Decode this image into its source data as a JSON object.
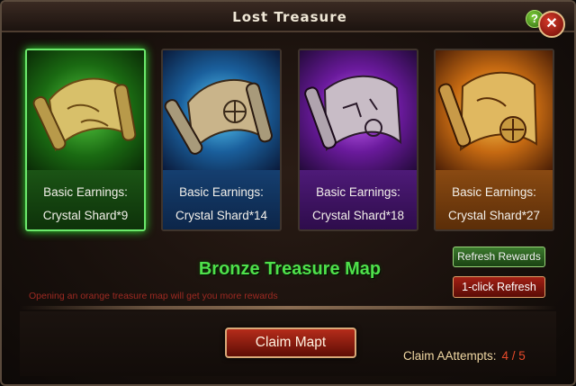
{
  "window": {
    "title": "Lost Treasure"
  },
  "titlebar": {
    "help_label": "?",
    "close_label": "✕"
  },
  "cards": [
    {
      "tier": "green",
      "line1": "Basic Earnings:",
      "line2": "Crystal Shard*9",
      "selected": true
    },
    {
      "tier": "blue",
      "line1": "Basic Earnings:",
      "line2": "Crystal Shard*14",
      "selected": false
    },
    {
      "tier": "purple",
      "line1": "Basic Earnings:",
      "line2": "Crystal Shard*18",
      "selected": false
    },
    {
      "tier": "orange",
      "line1": "Basic Earnings:",
      "line2": "Crystal Shard*27",
      "selected": false
    }
  ],
  "current_map": "Bronze Treasure Map",
  "hint": "Opening an orange treasure map will get you more rewards",
  "buttons": {
    "refresh": "Refresh Rewards",
    "one_click": "1-click Refresh",
    "claim": "Claim Mapt"
  },
  "attempts": {
    "label": "Claim AAttempts:",
    "value": "4 / 5"
  },
  "colors": {
    "green": "#2fdc2f",
    "blue": "#1a5f9c",
    "purple": "#6a1a9c",
    "orange": "#c66a12",
    "map_name": "#4fe04b",
    "hint": "#9e2a22"
  },
  "icons": {
    "help": "question-mark-icon",
    "close": "close-icon",
    "map_art": "treasure-map-scroll-icon"
  }
}
